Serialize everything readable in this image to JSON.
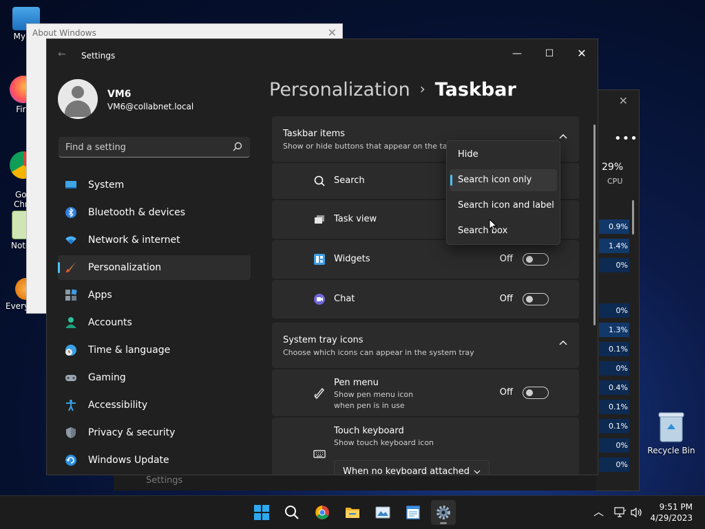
{
  "desktop": {
    "icons": [
      {
        "label": "My Co",
        "icon": "computer-icon"
      },
      {
        "label": "Fire",
        "icon": "firefox-icon"
      },
      {
        "label": "Goo\nChro",
        "icon": "chrome-icon"
      },
      {
        "label": "Notep",
        "icon": "notepad-icon"
      },
      {
        "label": "Everything",
        "icon": "everything-icon"
      }
    ],
    "recycle_bin": "Recycle Bin"
  },
  "about_window": {
    "title": "About Windows"
  },
  "task_manager": {
    "cpu_percent": "29%",
    "cpu_label": "CPU",
    "values": [
      "0.9%",
      "1.4%",
      "0%",
      "0%",
      "1.3%",
      "0.1%",
      "0%",
      "0.4%",
      "0.1%",
      "0.1%",
      "0%",
      "0%"
    ]
  },
  "settings": {
    "app_title": "Settings",
    "user": {
      "name": "VM6",
      "email": "VM6@collabnet.local"
    },
    "search_placeholder": "Find a setting",
    "nav": [
      {
        "label": "System",
        "icon": "system-icon"
      },
      {
        "label": "Bluetooth & devices",
        "icon": "bluetooth-icon"
      },
      {
        "label": "Network & internet",
        "icon": "wifi-icon"
      },
      {
        "label": "Personalization",
        "icon": "brush-icon",
        "active": true
      },
      {
        "label": "Apps",
        "icon": "apps-icon"
      },
      {
        "label": "Accounts",
        "icon": "accounts-icon"
      },
      {
        "label": "Time & language",
        "icon": "clock-globe-icon"
      },
      {
        "label": "Gaming",
        "icon": "gamepad-icon"
      },
      {
        "label": "Accessibility",
        "icon": "accessibility-icon"
      },
      {
        "label": "Privacy & security",
        "icon": "shield-icon"
      },
      {
        "label": "Windows Update",
        "icon": "update-icon"
      }
    ],
    "breadcrumb": {
      "parent": "Personalization",
      "separator": "›",
      "current": "Taskbar"
    },
    "taskbar_items": {
      "title": "Taskbar items",
      "subtitle": "Show or hide buttons that appear on the tas",
      "rows": [
        {
          "label": "Search",
          "icon": "search-icon"
        },
        {
          "label": "Task view",
          "icon": "task-view-icon"
        },
        {
          "label": "Widgets",
          "icon": "widgets-icon",
          "state": "Off"
        },
        {
          "label": "Chat",
          "icon": "chat-icon",
          "state": "Off"
        }
      ]
    },
    "system_tray": {
      "title": "System tray icons",
      "subtitle": "Choose which icons can appear in the system tray",
      "pen_menu": {
        "label": "Pen menu",
        "sub1": "Show pen menu icon",
        "sub2": "when pen is in use",
        "state": "Off"
      },
      "touch_keyboard": {
        "label": "Touch keyboard",
        "sub": "Show touch keyboard icon",
        "dropdown": "When no keyboard attached"
      }
    },
    "search_popup": {
      "options": [
        "Hide",
        "Search icon only",
        "Search icon and label",
        "Search box"
      ],
      "selected": "Search icon only"
    }
  },
  "behind_strip": "Settings",
  "taskbar": {
    "apps": [
      "start-icon",
      "search-icon",
      "chrome-icon",
      "file-explorer-icon",
      "photos-icon",
      "notepad-icon",
      "settings-gear-icon"
    ],
    "time": "9:51 PM",
    "date": "4/29/2023"
  },
  "colors": {
    "accent": "#4cc2ff",
    "window_bg": "#202020",
    "card_bg": "#2b2b2b"
  }
}
